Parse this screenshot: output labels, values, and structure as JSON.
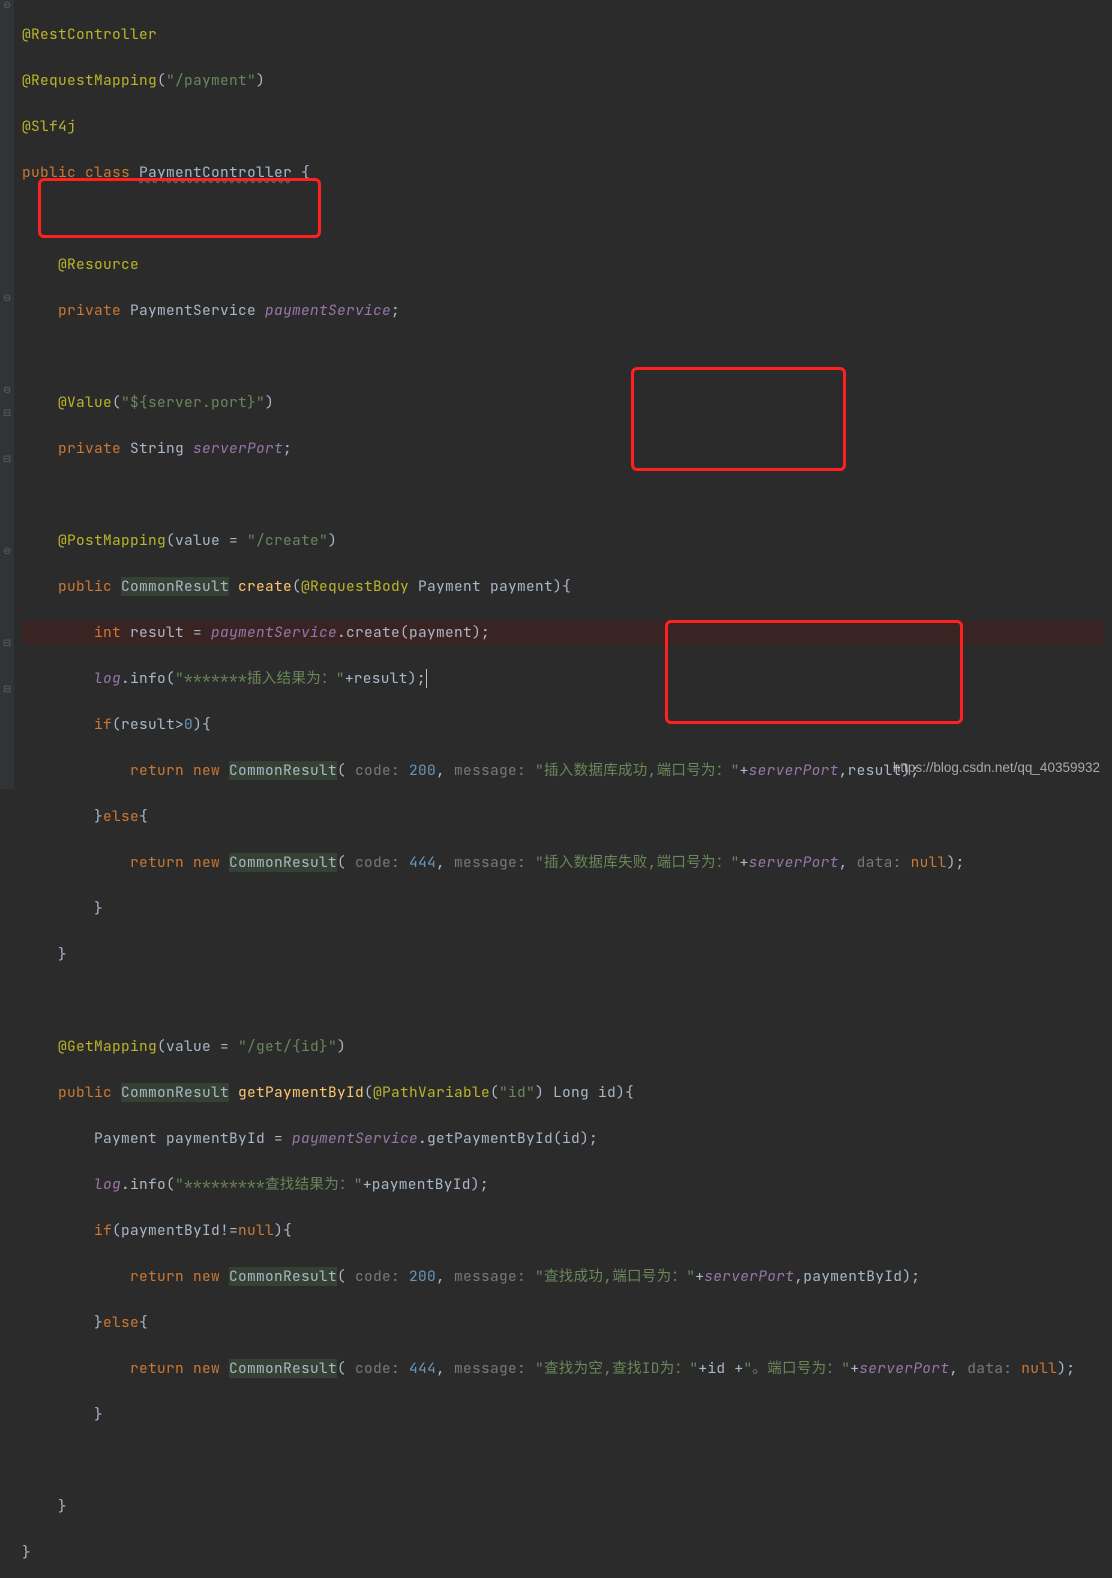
{
  "code": {
    "l1_annotation": "@RestController",
    "l2_annotation": "@RequestMapping",
    "l2_paren_open": "(",
    "l2_string": "\"/payment\"",
    "l2_paren_close": ")",
    "l3_annotation": "@Slf4j",
    "l4_public": "public ",
    "l4_class": "class ",
    "l4_classname": "PaymentController",
    "l4_brace": " {",
    "l6_annotation": "@Resource",
    "l7_private": "private ",
    "l7_type": "PaymentService ",
    "l7_field": "paymentService",
    "l7_semi": ";",
    "l9_annotation": "@Value",
    "l9_paren_open": "(",
    "l9_string": "\"${server.port}\"",
    "l9_paren_close": ")",
    "l10_private": "private ",
    "l10_type": "String ",
    "l10_field": "serverPort",
    "l10_semi": ";",
    "l12_annotation": "@PostMapping",
    "l12_paren_open": "(",
    "l12_value": "value ",
    "l12_eq": "= ",
    "l12_string": "\"/create\"",
    "l12_paren_close": ")",
    "l13_public": "public ",
    "l13_type": "CommonResult",
    "l13_method": " create",
    "l13_paren_open": "(",
    "l13_anno": "@RequestBody ",
    "l13_ptype": "Payment ",
    "l13_pname": "payment",
    "l13_paren_close": "){",
    "l14_int": "int ",
    "l14_result": "result ",
    "l14_eq": "= ",
    "l14_field": "paymentService",
    "l14_dot": ".create(payment)",
    "l14_semi": ";",
    "l15_log": "log",
    "l15_info": ".info(",
    "l15_string": "\"*******插入结果为：\"",
    "l15_plus": "+result)",
    "l15_semi": ";",
    "l16_if": "if",
    "l16_cond": "(result>",
    "l16_zero": "0",
    "l16_close": "){",
    "l17_return": "return new ",
    "l17_type": "CommonResult",
    "l17_open": "( ",
    "l17_hint1": "code: ",
    "l17_code": "200",
    "l17_comma1": ", ",
    "l17_hint2": "message: ",
    "l17_msg": "\"插入数据库成功,端口号为：\"",
    "l17_plus": "+",
    "l17_sp": "serverPort",
    "l17_comma2": ",",
    "l17_res": "result)",
    "l17_semi": ";",
    "l18_close": "}",
    "l18_else": "else",
    "l18_open": "{",
    "l19_return": "return new ",
    "l19_type": "CommonResult",
    "l19_open": "( ",
    "l19_hint1": "code: ",
    "l19_code": "444",
    "l19_comma1": ", ",
    "l19_hint2": "message: ",
    "l19_msg": "\"插入数据库失败,端口号为：\"",
    "l19_plus": "+",
    "l19_sp": "serverPort",
    "l19_comma2": ", ",
    "l19_hint3": "data: ",
    "l19_null": "null",
    "l19_close": ")",
    "l19_semi": ";",
    "l20_close": "}",
    "l21_close": "}",
    "l23_annotation": "@GetMapping",
    "l23_paren_open": "(",
    "l23_value": "value ",
    "l23_eq": "= ",
    "l23_string": "\"/get/{id}\"",
    "l23_paren_close": ")",
    "l24_public": "public ",
    "l24_type": "CommonResult",
    "l24_method": " getPaymentById",
    "l24_paren_open": "(",
    "l24_anno": "@PathVariable",
    "l24_annoopen": "(",
    "l24_annostr": "\"id\"",
    "l24_annoclose": ") ",
    "l24_ptype": "Long ",
    "l24_pname": "id",
    "l24_paren_close": "){",
    "l25_type": "Payment ",
    "l25_var": "paymentById ",
    "l25_eq": "= ",
    "l25_field": "paymentService",
    "l25_call": ".getPaymentById(id)",
    "l25_semi": ";",
    "l26_log": "log",
    "l26_info": ".info(",
    "l26_string": "\"*********查找结果为：\"",
    "l26_plus": "+paymentById)",
    "l26_semi": ";",
    "l27_if": "if",
    "l27_cond": "(paymentById!=",
    "l27_null": "null",
    "l27_close": "){",
    "l28_return": "return new ",
    "l28_type": "CommonResult",
    "l28_open": "( ",
    "l28_hint1": "code: ",
    "l28_code": "200",
    "l28_comma1": ", ",
    "l28_hint2": "message: ",
    "l28_msg": "\"查找成功,端口号为：\"",
    "l28_plus": "+",
    "l28_sp": "serverPort",
    "l28_comma2": ",paymentById)",
    "l28_semi": ";",
    "l29_close": "}",
    "l29_else": "else",
    "l29_open": "{",
    "l30_return": "return new ",
    "l30_type": "CommonResult",
    "l30_open": "( ",
    "l30_hint1": "code: ",
    "l30_code": "444",
    "l30_comma1": ", ",
    "l30_hint2": "message: ",
    "l30_msg": "\"查找为空,查找ID为：\"",
    "l30_plus1": "+id +",
    "l30_msg2": "\"。端口号为：\"",
    "l30_plus2": "+",
    "l30_sp": "serverPort",
    "l30_comma2": ", ",
    "l30_hint3": "data: ",
    "l30_null": "null",
    "l30_close": ")",
    "l30_semi": ";",
    "l31_close": "}",
    "l33_close": "}",
    "l34_close": "}"
  },
  "watermark": "https://blog.csdn.net/qq_40359932"
}
